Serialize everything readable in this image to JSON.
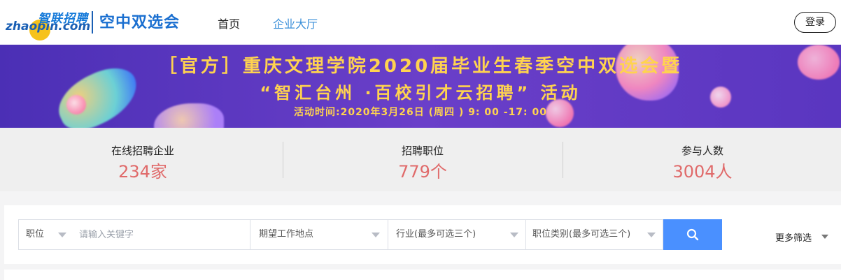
{
  "header": {
    "logo_cn": "智联招聘",
    "logo_en": "zhaopin.com",
    "brand": "空中双选会",
    "nav": {
      "home": "首页",
      "hall": "企业大厅"
    },
    "login": "登录"
  },
  "banner": {
    "line1": "［官方］重庆文理学院2020届毕业生春季空中双选会暨",
    "line2": "“智汇台州 ·百校引才云招聘” 活动",
    "line3": "活动时间:2020年3月26日 (周四 ) 9: 00 -17: 00"
  },
  "stats": [
    {
      "label": "在线招聘企业",
      "value": "234家"
    },
    {
      "label": "招聘职位",
      "value": "779个"
    },
    {
      "label": "参与人数",
      "value": "3004人"
    }
  ],
  "search": {
    "type_select": "职位",
    "keyword_placeholder": "请输入关键字",
    "location": "期望工作地点",
    "industry": "行业(最多可选三个)",
    "category": "职位类别(最多可选三个)",
    "more_filters": "更多筛选"
  },
  "colors": {
    "brand_blue": "#1a6fd0",
    "nav_active": "#3a8fd9",
    "stat_value": "#e06a6a",
    "banner_text": "#ffd34f",
    "search_button": "#4a90ff"
  },
  "icons": [
    "search-icon",
    "chevron-down-icon"
  ]
}
